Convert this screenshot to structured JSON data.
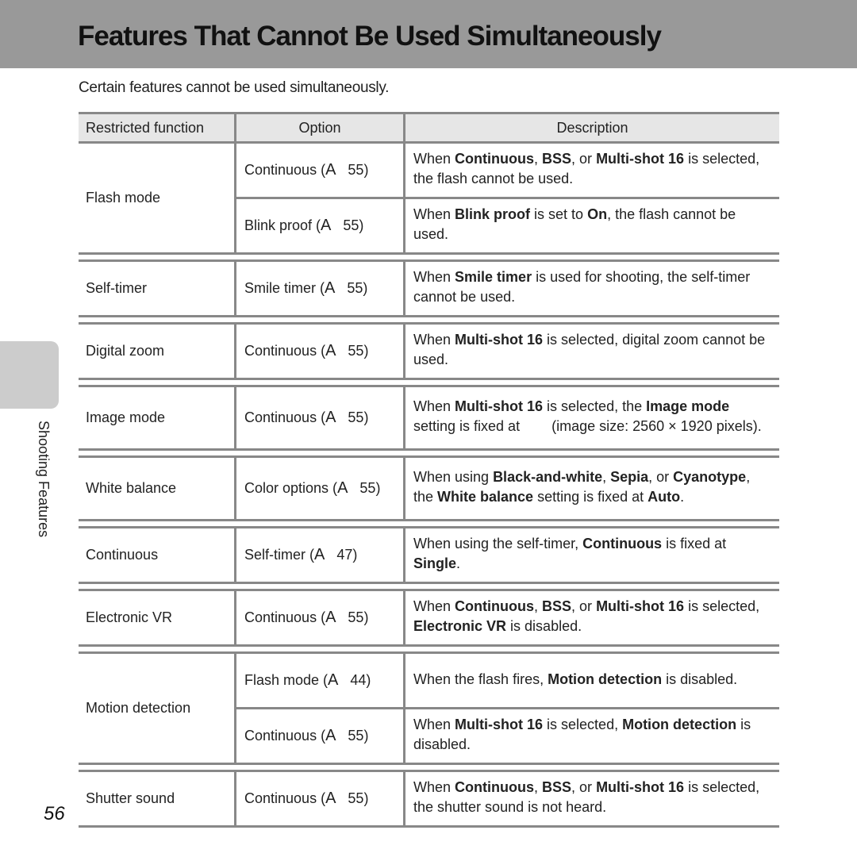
{
  "page": {
    "title": "Features That Cannot Be Used Simultaneously",
    "intro": "Certain features cannot be used simultaneously.",
    "side_label": "Shooting Features",
    "page_number": "56"
  },
  "table": {
    "headers": [
      "Restricted function",
      "Option",
      "Description"
    ],
    "rows": [
      {
        "function": "Flash mode",
        "option": "Continuous (",
        "ref": "A",
        "page": "55)",
        "description": [
          [
            "When ",
            false
          ],
          [
            "Continuous",
            true
          ],
          [
            ", ",
            false
          ],
          [
            "BSS",
            true
          ],
          [
            ", or ",
            false
          ],
          [
            "Multi-shot 16",
            true
          ],
          [
            " is selected, the flash cannot be used.",
            false
          ]
        ]
      },
      {
        "function": "",
        "option": "Blink proof (",
        "ref": "A",
        "page": "55)",
        "description": [
          [
            "When ",
            false
          ],
          [
            "Blink proof",
            true
          ],
          [
            " is set to ",
            false
          ],
          [
            "On",
            true
          ],
          [
            ", the flash cannot be used.",
            false
          ]
        ]
      },
      {
        "function": "Self-timer",
        "option": "Smile timer (",
        "ref": "A",
        "page": "55)",
        "description": [
          [
            "When ",
            false
          ],
          [
            "Smile timer",
            true
          ],
          [
            " is used for shooting, the self-timer cannot be used.",
            false
          ]
        ]
      },
      {
        "function": "Digital zoom",
        "option": "Continuous (",
        "ref": "A",
        "page": "55)",
        "description": [
          [
            "When ",
            false
          ],
          [
            "Multi-shot 16",
            true
          ],
          [
            " is selected, digital zoom cannot be used.",
            false
          ]
        ]
      },
      {
        "function": "Image mode",
        "option": "Continuous (",
        "ref": "A",
        "page": "55)",
        "description": [
          [
            "When ",
            false
          ],
          [
            "Multi-shot 16",
            true
          ],
          [
            " is selected, the ",
            false
          ],
          [
            "Image mode",
            true
          ],
          [
            " setting is fixed at        (image size: 2560 × 1920 pixels).",
            false
          ]
        ]
      },
      {
        "function": "White balance",
        "option": "Color options (",
        "ref": "A",
        "page": "55)",
        "description": [
          [
            "When using ",
            false
          ],
          [
            "Black-and-white",
            true
          ],
          [
            ", ",
            false
          ],
          [
            "Sepia",
            true
          ],
          [
            ", or ",
            false
          ],
          [
            "Cyanotype",
            true
          ],
          [
            ", the ",
            false
          ],
          [
            "White balance",
            true
          ],
          [
            " setting is fixed at ",
            false
          ],
          [
            "Auto",
            true
          ],
          [
            ".",
            false
          ]
        ]
      },
      {
        "function": "Continuous",
        "option": "Self-timer (",
        "ref": "A",
        "page": "47)",
        "description": [
          [
            "When using the self-timer, ",
            false
          ],
          [
            "Continuous",
            true
          ],
          [
            " is fixed at ",
            false
          ],
          [
            "Single",
            true
          ],
          [
            ".",
            false
          ]
        ]
      },
      {
        "function": "Electronic VR",
        "option": "Continuous (",
        "ref": "A",
        "page": "55)",
        "description": [
          [
            "When ",
            false
          ],
          [
            "Continuous",
            true
          ],
          [
            ", ",
            false
          ],
          [
            "BSS",
            true
          ],
          [
            ", or ",
            false
          ],
          [
            "Multi-shot 16",
            true
          ],
          [
            " is selected, ",
            false
          ],
          [
            "Electronic VR",
            true
          ],
          [
            " is disabled.",
            false
          ]
        ]
      },
      {
        "function": "Motion detection",
        "option": "Flash mode (",
        "ref": "A",
        "page": "44)",
        "description": [
          [
            "When the flash fires, ",
            false
          ],
          [
            "Motion detection",
            true
          ],
          [
            " is disabled.",
            false
          ]
        ]
      },
      {
        "function": "",
        "option": "Continuous (",
        "ref": "A",
        "page": "55)",
        "description": [
          [
            "When ",
            false
          ],
          [
            "Multi-shot 16",
            true
          ],
          [
            " is selected, ",
            false
          ],
          [
            "Motion detection",
            true
          ],
          [
            " is disabled.",
            false
          ]
        ]
      },
      {
        "function": "Shutter sound",
        "option": "Continuous (",
        "ref": "A",
        "page": "55)",
        "description": [
          [
            "When ",
            false
          ],
          [
            "Continuous",
            true
          ],
          [
            ", ",
            false
          ],
          [
            "BSS",
            true
          ],
          [
            ", or ",
            false
          ],
          [
            "Multi-shot 16",
            true
          ],
          [
            " is selected, the shutter sound is not heard.",
            false
          ]
        ]
      }
    ]
  }
}
